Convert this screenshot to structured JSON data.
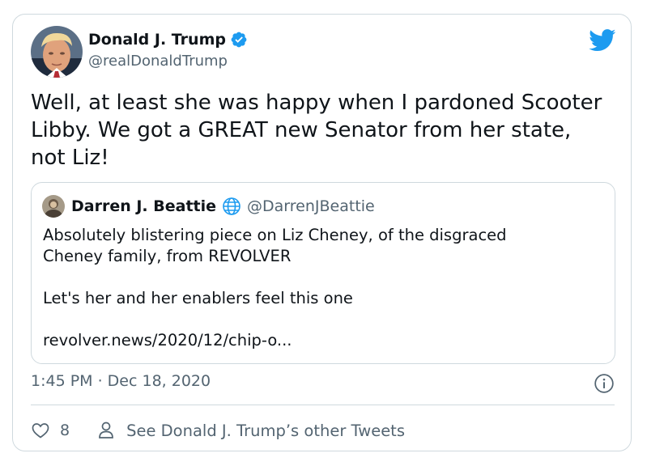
{
  "author": {
    "display_name": "Donald J. Trump",
    "handle": "@realDonaldTrump"
  },
  "tweet": {
    "text": "Well, at least she was happy when I pardoned Scooter\nLibby. We got a GREAT new Senator from her state,\nnot Liz!",
    "timestamp": "1:45 PM · Dec 18, 2020",
    "like_count": "8",
    "other_tweets_label": "See Donald J. Trump’s other Tweets"
  },
  "quoted_tweet": {
    "display_name": "Darren J. Beattie",
    "handle": "@DarrenJBeattie",
    "text": "Absolutely blistering piece on Liz Cheney, of the disgraced\nCheney family, from REVOLVER\n\nLet's her and her enablers feel this one\n\nrevolver.news/2020/12/chip-o..."
  },
  "icons": {
    "verified": "verified-badge-icon",
    "brand": "twitter-bird-icon",
    "globe": "globe-icon",
    "info": "info-icon",
    "like": "heart-icon",
    "profile": "person-icon"
  },
  "colors": {
    "brand": "#1d9bf0",
    "text": "#0f1419",
    "secondary": "#536471",
    "border": "#cfd9de"
  }
}
